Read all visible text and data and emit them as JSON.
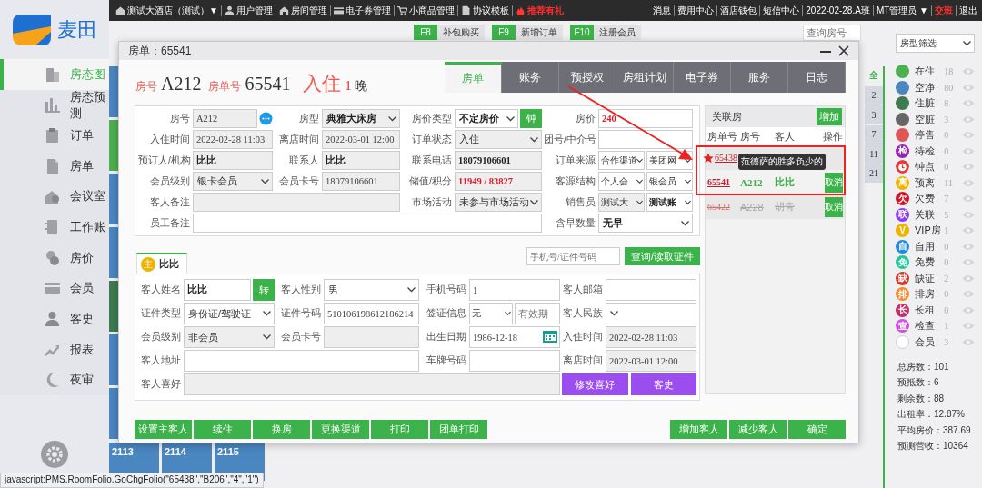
{
  "sidebar": {
    "logo": "麦田",
    "items": [
      {
        "label": "房态图",
        "selected": true
      },
      {
        "label": "房态预测",
        "selected": false
      },
      {
        "label": "订单",
        "selected": false
      },
      {
        "label": "房单",
        "selected": false
      },
      {
        "label": "会议室",
        "selected": false
      },
      {
        "label": "工作账",
        "selected": false
      },
      {
        "label": "房价",
        "selected": false
      },
      {
        "label": "会员",
        "selected": false
      },
      {
        "label": "客史",
        "selected": false
      },
      {
        "label": "报表",
        "selected": false
      },
      {
        "label": "夜审",
        "selected": false
      }
    ]
  },
  "topbar": {
    "left": [
      {
        "label": "测试大酒店（测试）▼",
        "highlight": false
      },
      {
        "label": "用户管理",
        "highlight": false
      },
      {
        "label": "房间管理",
        "highlight": false
      },
      {
        "label": "电子券管理",
        "highlight": false
      },
      {
        "label": "小商品管理",
        "highlight": false
      },
      {
        "label": "协议模板",
        "highlight": false
      },
      {
        "label": "推荐有礼",
        "highlight": true
      }
    ],
    "right": [
      {
        "label": "消息",
        "highlight": false
      },
      {
        "label": "费用中心",
        "highlight": false
      },
      {
        "label": "酒店钱包",
        "highlight": false
      },
      {
        "label": "短信中心",
        "highlight": false
      },
      {
        "label": "2022-02-28.A班",
        "highlight": false
      },
      {
        "label": "MT管理员 ▼",
        "highlight": false
      },
      {
        "label": "交班",
        "highlight": true
      },
      {
        "label": "退出",
        "highlight": false
      }
    ]
  },
  "toolbar": {
    "shortcuts": [
      {
        "key": "F8",
        "label": "补包购买"
      },
      {
        "key": "F9",
        "label": "新增订单"
      },
      {
        "key": "F10",
        "label": "注册会员"
      }
    ],
    "search": {
      "placeholder": "查询房号"
    }
  },
  "room_tiles": [
    {
      "color": "#4a86c0"
    },
    {
      "color": "#4caf50"
    },
    {
      "color": "#4a86c0"
    },
    {
      "color": "#4a86c0"
    },
    {
      "color": "#3d7a50"
    },
    {
      "color": "#4a86c0"
    },
    {
      "color": "#4a86c0"
    }
  ],
  "bottom_tiles": [
    {
      "number": "2113",
      "color": "#4a86c0"
    },
    {
      "number": "2114",
      "color": "#4a86c0"
    },
    {
      "number": "2115",
      "color": "#4a86c0"
    }
  ],
  "floor_tabs": [
    {
      "label": "全",
      "selected": true
    },
    {
      "label": "2",
      "selected": false
    },
    {
      "label": "3",
      "selected": false
    },
    {
      "label": "7",
      "selected": false
    },
    {
      "label": "11",
      "selected": false
    },
    {
      "label": "21",
      "selected": false
    }
  ],
  "room_type_filter": {
    "value": "房型筛选"
  },
  "legend": [
    {
      "label": "在住",
      "count": "18",
      "color": "#4caf50",
      "kind": "dot"
    },
    {
      "label": "空净",
      "count": "80",
      "color": "#4a86c0",
      "kind": "dot"
    },
    {
      "label": "住脏",
      "count": "8",
      "color": "#3d7a50",
      "kind": "dot"
    },
    {
      "label": "空脏",
      "count": "3",
      "color": "#666666",
      "kind": "dot"
    },
    {
      "label": "停售",
      "count": "0",
      "color": "#e05555",
      "kind": "dot"
    },
    {
      "label": "待检",
      "count": "0",
      "color": "#9b1fb5",
      "kind": "badge",
      "badge": "检"
    },
    {
      "label": "钟点",
      "count": "0",
      "color": "#e53935",
      "kind": "clock"
    },
    {
      "label": "预离",
      "count": "11",
      "color": "#f0b400",
      "kind": "badge",
      "badge": "离"
    },
    {
      "label": "欠费",
      "count": "7",
      "color": "#d0152b",
      "kind": "badge",
      "badge": "欠"
    },
    {
      "label": "关联",
      "count": "5",
      "color": "#8a3cf0",
      "kind": "badge",
      "badge": "联"
    },
    {
      "label": "VIP房",
      "count": "1",
      "color": "#f0b400",
      "kind": "badge",
      "badge": "V"
    },
    {
      "label": "自用",
      "count": "0",
      "color": "#1e88e5",
      "kind": "badge",
      "badge": "自"
    },
    {
      "label": "免费",
      "count": "0",
      "color": "#1ec99a",
      "kind": "badge",
      "badge": "免"
    },
    {
      "label": "缺证",
      "count": "2",
      "color": "#d23b2e",
      "kind": "badge",
      "badge": "缺"
    },
    {
      "label": "排房",
      "count": "0",
      "color": "#f58a2c",
      "kind": "badge",
      "badge": "排"
    },
    {
      "label": "长租",
      "count": "0",
      "color": "#c0306a",
      "kind": "badge",
      "badge": "长"
    },
    {
      "label": "检查",
      "count": "1",
      "color": "#d050e0",
      "kind": "badge",
      "badge": "查"
    },
    {
      "label": "会员",
      "count": "3",
      "color": "#ffffff",
      "kind": "ring"
    }
  ],
  "stats": [
    "总房数：101",
    "预抵数：6",
    "剩余数：88",
    "出租率：12.87%",
    "平均房价：387.69",
    "预测营收：10364"
  ],
  "dialog": {
    "title": "房单：65541",
    "header": {
      "room_label": "房号",
      "room": "A212",
      "folio_label": "房单号",
      "folio": "65541",
      "status": "入住",
      "nights": "1",
      "nights_unit": "晚"
    },
    "tabs": [
      {
        "label": "房单",
        "selected": true
      },
      {
        "label": "账务",
        "selected": false
      },
      {
        "label": "预授权",
        "selected": false
      },
      {
        "label": "房租计划",
        "selected": false
      },
      {
        "label": "电子券",
        "selected": false
      },
      {
        "label": "服务",
        "selected": false
      },
      {
        "label": "日志",
        "selected": false
      }
    ],
    "order_form": {
      "fields": [
        {
          "label": "房号",
          "kind": "input",
          "value": "A212",
          "disabled": true,
          "bold": false,
          "alert": false,
          "more": true
        },
        {
          "label": "房型",
          "kind": "select",
          "value": "典雅大床房",
          "disabled": true,
          "bold": true,
          "alert": false
        },
        {
          "label": "房价类型",
          "kind": "select",
          "value": "不定房价",
          "disabled": false,
          "bold": true,
          "alert": false,
          "button": "钟"
        },
        {
          "label": "房价",
          "kind": "input",
          "value": "240",
          "disabled": false,
          "bold": true,
          "alert": true
        },
        {
          "label": "入住时间",
          "kind": "input",
          "value": "2022-02-28 11:03",
          "disabled": true,
          "bold": false,
          "alert": false
        },
        {
          "label": "离店时间",
          "kind": "input",
          "value": "2022-03-01 12:00",
          "disabled": true,
          "bold": false,
          "alert": false
        },
        {
          "label": "订单状态",
          "kind": "select",
          "value": "入住",
          "disabled": true,
          "bold": false,
          "alert": false
        },
        {
          "label": "团号/中介号",
          "kind": "input",
          "disabled": false
        },
        {
          "label": "预订人/机构",
          "kind": "input",
          "value": "比比",
          "disabled": true,
          "bold": true,
          "alert": false
        },
        {
          "label": "联系人",
          "kind": "input",
          "value": "比比",
          "disabled": true,
          "bold": true,
          "alert": false
        },
        {
          "label": "联系电话",
          "kind": "input",
          "value": "18079106601",
          "disabled": true,
          "bold": true,
          "alert": false
        },
        {
          "label": "订单来源",
          "kind": "pair",
          "parts": [
            {
              "kind": "select",
              "value": "合作渠道",
              "disabled": false,
              "bold": false,
              "alert": false
            },
            {
              "kind": "select",
              "value": "美团网",
              "disabled": false,
              "bold": false,
              "alert": false
            }
          ]
        },
        {
          "label": "会员级别",
          "kind": "select",
          "value": "银卡会员",
          "disabled": true,
          "bold": false,
          "alert": false
        },
        {
          "label": "会员卡号",
          "kind": "input",
          "value": "18079106601",
          "disabled": true,
          "bold": false,
          "alert": false
        },
        {
          "label": "储值/积分",
          "kind": "input",
          "value": "11949 / 83827",
          "disabled": true,
          "bold": true,
          "alert": true
        },
        {
          "label": "客源结构",
          "kind": "pair",
          "parts": [
            {
              "kind": "select",
              "value": "个人会",
              "disabled": false,
              "bold": false,
              "alert": false
            },
            {
              "kind": "select",
              "value": "银会员",
              "disabled": false,
              "bold": false,
              "alert": false
            }
          ]
        },
        {
          "label": "客人备注",
          "kind": "note",
          "disabled": true
        },
        {
          "label": "市场活动",
          "kind": "select",
          "value": "未参与市场活动",
          "disabled": true,
          "bold": false,
          "alert": false
        },
        {
          "label": "销售员",
          "kind": "pair",
          "parts": [
            {
              "kind": "select",
              "value": "测试大",
              "disabled": true,
              "bold": false,
              "alert": false
            },
            {
              "kind": "select",
              "value": "测试账",
              "disabled": false,
              "bold": true,
              "alert": false
            }
          ]
        },
        {
          "label": "员工备注",
          "kind": "long_note",
          "disabled": false
        },
        {
          "label": "含早数量",
          "kind": "select",
          "value": "无早",
          "disabled": false,
          "bold": true,
          "alert": false
        }
      ]
    },
    "guest_search": {
      "placeholder": "手机号/证件号码",
      "button": "查询/读取证件"
    },
    "guest_tabs": [
      {
        "label": "比比",
        "badge": "主",
        "selected": true
      }
    ],
    "guest_form": {
      "fields": [
        {
          "label": "客人姓名",
          "kind": "input",
          "value": "比比",
          "disabled": false,
          "bold": true,
          "alert": false,
          "button": "转"
        },
        {
          "label": "客人性别",
          "kind": "select",
          "value": "男",
          "disabled": false,
          "bold": false,
          "alert": false
        },
        {
          "label": "手机号码",
          "kind": "input",
          "value": "1",
          "disabled": false,
          "bold": false,
          "alert": false
        },
        {
          "label": "客人邮箱",
          "kind": "input",
          "disabled": false
        },
        {
          "label": "证件类型",
          "kind": "select",
          "value": "身份证/驾驶证",
          "disabled": false,
          "bold": false,
          "alert": false
        },
        {
          "label": "证件号码",
          "kind": "input",
          "value": "510106198612186214",
          "disabled": false,
          "bold": false,
          "alert": false
        },
        {
          "label": "签证信息",
          "kind": "pair",
          "parts": [
            {
              "kind": "select",
              "value": "无",
              "disabled": false,
              "bold": false,
              "alert": false
            },
            {
              "kind": "input",
              "placeholder": "有效期",
              "disabled": false
            }
          ]
        },
        {
          "label": "客人民族",
          "kind": "select",
          "disabled": false
        },
        {
          "label": "会员级别",
          "kind": "select",
          "value": "非会员",
          "disabled": true,
          "bold": false,
          "alert": false
        },
        {
          "label": "会员卡号",
          "kind": "input",
          "disabled": true
        },
        {
          "label": "出生日期",
          "kind": "input",
          "value": "1986-12-18",
          "disabled": false,
          "bold": false,
          "alert": false,
          "calendar": true
        },
        {
          "label": "入住时间",
          "kind": "input",
          "value": "2022-02-28 11:03",
          "disabled": true,
          "bold": false,
          "alert": false
        },
        {
          "label": "客人地址",
          "kind": "note",
          "disabled": false
        },
        {
          "label": "车牌号码",
          "kind": "input",
          "disabled": false
        },
        {
          "label": "离店时间",
          "kind": "input",
          "value": "2022-03-01 12:00",
          "disabled": true,
          "bold": false,
          "alert": false
        },
        {
          "label": "客人喜好",
          "kind": "long_note",
          "disabled": true,
          "buttons": [
            "修改喜好",
            "客史"
          ]
        }
      ]
    },
    "linked_rooms": {
      "title": "关联房",
      "add_button": "增加",
      "columns": [
        "房单号",
        "房号",
        "客人",
        "操作"
      ],
      "rows": [
        {
          "folio": "65438",
          "starred": true,
          "current": false,
          "cancelled": false
        },
        {
          "folio": "65541",
          "room": "A212",
          "guest": "比比",
          "starred": false,
          "current": true,
          "cancelled": false,
          "action": "取消"
        },
        {
          "folio": "65422",
          "room": "A228",
          "guest": "胡青",
          "starred": false,
          "current": false,
          "cancelled": true,
          "action": "取消"
        }
      ],
      "tooltip": "范德萨的胜多负少的"
    },
    "left_buttons": [
      "设置主客人",
      "续住",
      "换房",
      "更换渠道",
      "打印",
      "团单打印"
    ],
    "right_buttons": [
      "增加客人",
      "减少客人",
      "确定"
    ]
  },
  "status_bar": "javascript:PMS.RoomFolio.GoChgFolio(\"65438\",\"B206\",\"4\",\"1\")"
}
